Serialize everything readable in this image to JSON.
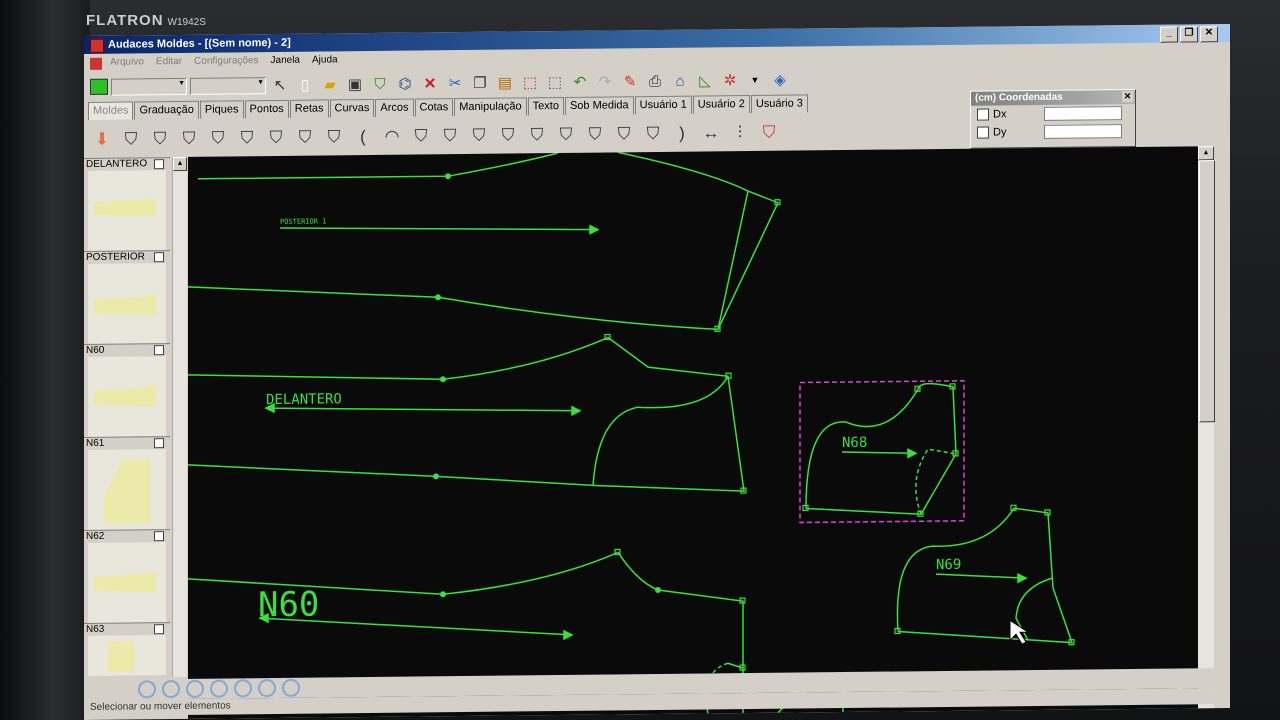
{
  "monitor": {
    "brand": "FLATRON",
    "model": "W1942S"
  },
  "window": {
    "title": "Audaces Moldes - [(Sem nome) - 2]"
  },
  "menu": [
    "Arquivo",
    "Editar",
    "Configurações",
    "Janela",
    "Ajuda"
  ],
  "tabs": [
    "Moldes",
    "Graduação",
    "Piques",
    "Pontos",
    "Retas",
    "Curvas",
    "Arcos",
    "Cotas",
    "Manipulação",
    "Texto",
    "Sob Medida",
    "Usuário 1",
    "Usuário 2",
    "Usuário 3"
  ],
  "coord_panel": {
    "title": "(cm) Coordenadas",
    "dx_label": "Dx",
    "dy_label": "Dy"
  },
  "thumbnails": [
    "DELANTERO",
    "POSTERIOR",
    "N60",
    "N61",
    "N62",
    "N63"
  ],
  "canvas_labels": {
    "posterior": "POSTERIOR 1",
    "delantero": "DELANTERO",
    "n60": "N60",
    "n68": "N68",
    "n69": "N69"
  },
  "status": "Selecionar ou mover elementos",
  "colors": {
    "pattern_line": "#3be03b",
    "selection": "#e040e0",
    "canvas": "#0a0a0a"
  }
}
